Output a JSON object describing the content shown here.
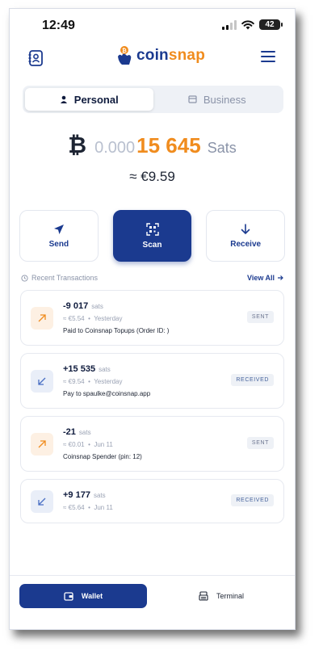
{
  "status_bar": {
    "time": "12:49",
    "battery": "42"
  },
  "header": {
    "brand": "coinsnap",
    "brand_prefix": "coin",
    "brand_suffix": "snap",
    "brand_colors": {
      "primary": "#1b3a8f",
      "accent": "#f08c1e"
    }
  },
  "tabs": [
    {
      "label": "Personal",
      "active": true,
      "icon": "person-icon"
    },
    {
      "label": "Business",
      "active": false,
      "icon": "store-icon"
    }
  ],
  "balance": {
    "symbol": "₿",
    "zeros": "0.000",
    "amount": "15 645",
    "unit": "Sats",
    "fiat": "≈ €9.59"
  },
  "actions": [
    {
      "label": "Send",
      "icon": "send-icon"
    },
    {
      "label": "Scan",
      "icon": "qr-scan-icon"
    },
    {
      "label": "Receive",
      "icon": "arrow-down-icon"
    }
  ],
  "recent": {
    "title": "Recent Transactions",
    "view_all": "View All"
  },
  "transactions": [
    {
      "amount": "-9 017",
      "unit": "sats",
      "fiat": "≈ €5.54",
      "date": "Yesterday",
      "description": "Paid to Coinsnap Topups (Order ID: )",
      "status": "SENT",
      "direction": "sent"
    },
    {
      "amount": "+15 535",
      "unit": "sats",
      "fiat": "≈ €9.54",
      "date": "Yesterday",
      "description": "Pay to spaulke@coinsnap.app",
      "status": "RECEIVED",
      "direction": "received"
    },
    {
      "amount": "-21",
      "unit": "sats",
      "fiat": "≈ €0.01",
      "date": "Jun 11",
      "description": "Coinsnap Spender (pin: 12)",
      "status": "SENT",
      "direction": "sent"
    },
    {
      "amount": "+9 177",
      "unit": "sats",
      "fiat": "≈ €5.64",
      "date": "Jun 11",
      "description": "",
      "status": "RECEIVED",
      "direction": "received"
    }
  ],
  "bottom_nav": [
    {
      "label": "Wallet",
      "active": true,
      "icon": "wallet-icon"
    },
    {
      "label": "Terminal",
      "active": false,
      "icon": "terminal-icon"
    }
  ]
}
